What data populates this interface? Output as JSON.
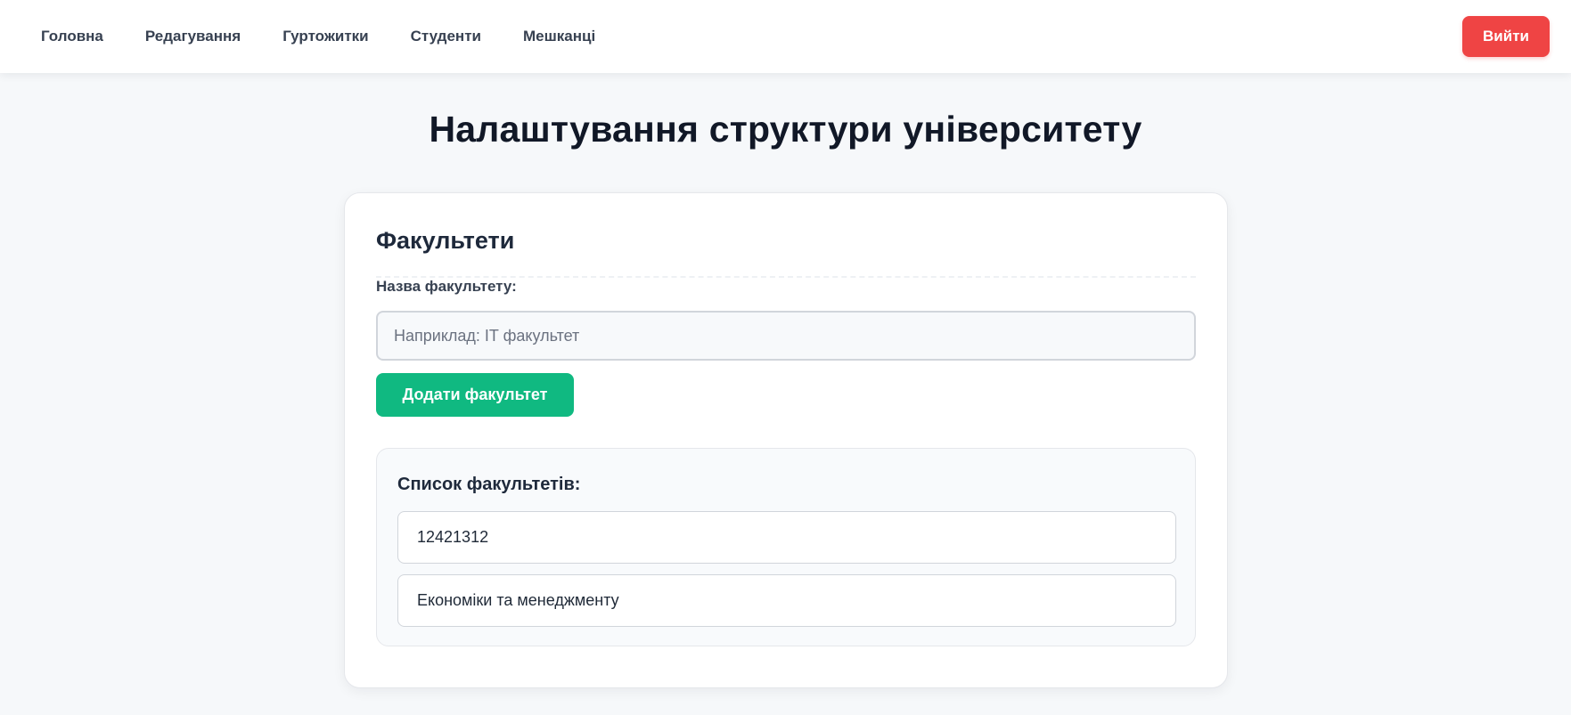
{
  "nav": {
    "links": [
      "Головна",
      "Редагування",
      "Гуртожитки",
      "Студенти",
      "Мешканці"
    ],
    "logout_label": "Вийти"
  },
  "page": {
    "title": "Налаштування структури університету"
  },
  "faculties": {
    "section_title": "Факультети",
    "field_label": "Назва факультету:",
    "input_value": "",
    "input_placeholder": "Наприклад: IT факультет",
    "add_button_label": "Додати факультет",
    "list_title": "Список факультетів:",
    "items": [
      "12421312",
      "Економіки та менеджменту"
    ]
  },
  "colors": {
    "accent_green": "#10b981",
    "danger_red": "#ef4444",
    "page_background": "#f6f8fa"
  }
}
